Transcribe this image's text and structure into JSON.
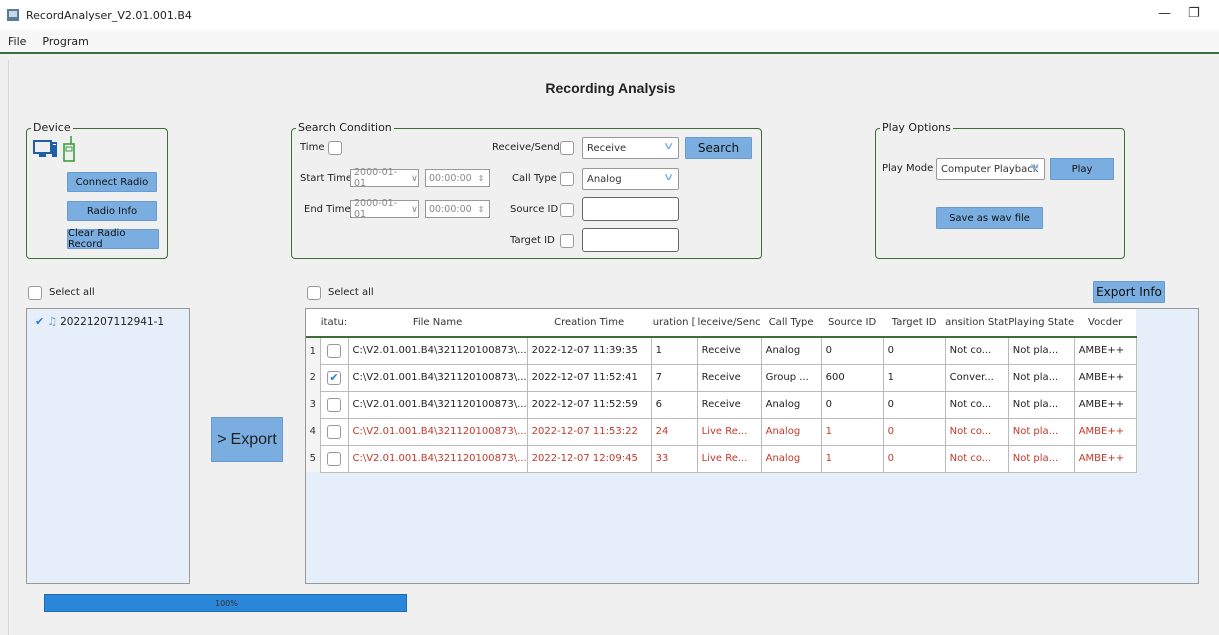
{
  "window": {
    "title": "RecordAnalyser_V2.01.001.B4",
    "minimize_glyph": "—",
    "restore_glyph": "❐"
  },
  "menu": [
    {
      "label": "File"
    },
    {
      "label": "Program"
    }
  ],
  "page_title": "Recording Analysis",
  "device": {
    "group_label": "Device",
    "icons": [
      "computer-icon",
      "radio-icon"
    ],
    "buttons": {
      "connect": "Connect Radio",
      "info": "Radio Info",
      "clear": "Clear Radio Record"
    }
  },
  "search": {
    "group_label": "Search Condition",
    "time_label": "Time",
    "start_label": "Start Time",
    "end_label": "End Time",
    "start_date": "2000-01-01",
    "start_time": "00:00:00",
    "end_date": "2000-01-01",
    "end_time": "00:00:00",
    "receive_send_label": "Receive/Send",
    "receive_send_value": "Receive",
    "call_type_label": "Call Type",
    "call_type_value": "Analog",
    "source_id_label": "Source ID",
    "target_id_label": "Target ID",
    "search_button": "Search"
  },
  "play": {
    "group_label": "Play Options",
    "mode_label": "Play Mode",
    "mode_value": "Computer Playback",
    "play_button": "Play",
    "save_button": "Save as wav file"
  },
  "left_panel": {
    "select_all": "Select all",
    "items": [
      {
        "label": "20221207112941-1",
        "checked": true
      }
    ]
  },
  "export_button": {
    "arrow": ">",
    "label": "Export"
  },
  "table_panel": {
    "select_all": "Select all",
    "export_info_button": "Export Info",
    "columns": [
      "itatu:",
      "File Name",
      "Creation Time",
      "uration [",
      "leceive/Senc",
      "Call Type",
      "Source ID",
      "Target ID",
      "ansition Stat",
      "Playing State",
      "Vocder"
    ],
    "rows": [
      {
        "num": "1",
        "checked": false,
        "highlight": false,
        "file": "C:\\V2.01.001.B4\\321120100873\\...",
        "time": "2022-12-07 11:39:35",
        "duration": "1",
        "rs": "Receive",
        "call": "Analog",
        "src": "0",
        "tgt": "0",
        "trans": "Not co...",
        "play": "Not pla...",
        "voc": "AMBE++"
      },
      {
        "num": "2",
        "checked": true,
        "highlight": false,
        "file": "C:\\V2.01.001.B4\\321120100873\\...",
        "time": "2022-12-07 11:52:41",
        "duration": "7",
        "rs": "Receive",
        "call": "Group ...",
        "src": "600",
        "tgt": "1",
        "trans": "Conver...",
        "play": "Not pla...",
        "voc": "AMBE++"
      },
      {
        "num": "3",
        "checked": false,
        "highlight": false,
        "file": "C:\\V2.01.001.B4\\321120100873\\...",
        "time": "2022-12-07 11:52:59",
        "duration": "6",
        "rs": "Receive",
        "call": "Analog",
        "src": "0",
        "tgt": "0",
        "trans": "Not co...",
        "play": "Not pla...",
        "voc": "AMBE++"
      },
      {
        "num": "4",
        "checked": false,
        "highlight": true,
        "file": "C:\\V2.01.001.B4\\321120100873\\...",
        "time": "2022-12-07 11:53:22",
        "duration": "24",
        "rs": "Live Re...",
        "call": "Analog",
        "src": "1",
        "tgt": "0",
        "trans": "Not co...",
        "play": "Not pla...",
        "voc": "AMBE++"
      },
      {
        "num": "5",
        "checked": false,
        "highlight": true,
        "file": "C:\\V2.01.001.B4\\321120100873\\...",
        "time": "2022-12-07 12:09:45",
        "duration": "33",
        "rs": "Live Re...",
        "call": "Analog",
        "src": "1",
        "tgt": "0",
        "trans": "Not co...",
        "play": "Not pla...",
        "voc": "AMBE++"
      }
    ]
  },
  "progress": {
    "label": "100%",
    "value": 100
  },
  "colors": {
    "accent": "#7aaee0",
    "progress": "#2a86d8",
    "highlight_text": "#c0392b",
    "group_border": "#3d6e35"
  }
}
